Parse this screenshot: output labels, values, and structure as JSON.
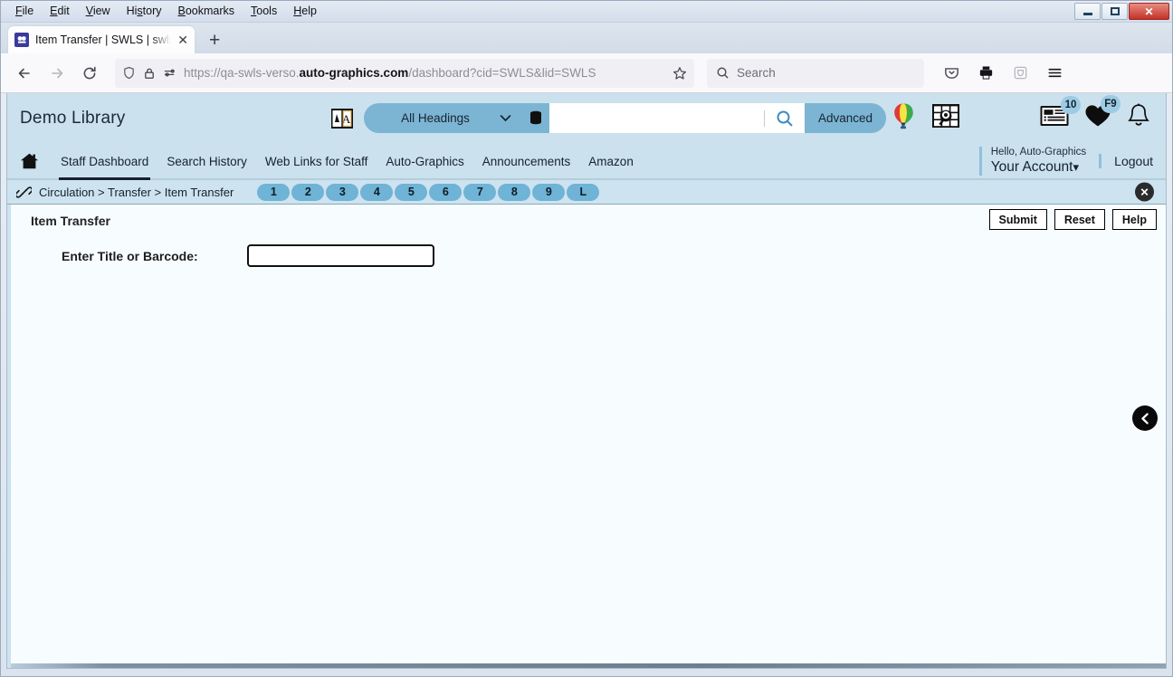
{
  "browser": {
    "menus": [
      "File",
      "Edit",
      "View",
      "History",
      "Bookmarks",
      "Tools",
      "Help"
    ],
    "window_controls": {
      "minimize": "minimize-button",
      "maximize": "maximize-button",
      "close": "✕"
    },
    "tab": {
      "title": "Item Transfer | SWLS | swls | Aut",
      "close": "✕",
      "new_tab": "+"
    },
    "url": {
      "prefix": "https://qa-swls-verso.",
      "domain": "auto-graphics.com",
      "suffix": "/dashboard?cid=SWLS&lid=SWLS"
    },
    "search": {
      "placeholder": "Search"
    }
  },
  "app": {
    "library_name": "Demo Library",
    "scope": {
      "selected": "All Headings",
      "caret": "⌄"
    },
    "search_box": {
      "value": "",
      "placeholder": ""
    },
    "advanced_label": "Advanced",
    "badges": {
      "list_count": "10",
      "favorites": "F9"
    },
    "nav": [
      {
        "label": "Staff Dashboard",
        "active": true
      },
      {
        "label": "Search History",
        "active": false
      },
      {
        "label": "Web Links for Staff",
        "active": false
      },
      {
        "label": "Auto-Graphics",
        "active": false
      },
      {
        "label": "Announcements",
        "active": false
      },
      {
        "label": "Amazon",
        "active": false
      }
    ],
    "account": {
      "greeting": "Hello, Auto-Graphics",
      "name": "Your Account",
      "caret": "⌄",
      "logout": "Logout"
    },
    "breadcrumb": {
      "path": "Circulation > Transfer > Item Transfer",
      "pills": [
        "1",
        "2",
        "3",
        "4",
        "5",
        "6",
        "7",
        "8",
        "9",
        "L"
      ],
      "close": "✕"
    },
    "content": {
      "title": "Item Transfer",
      "buttons": [
        {
          "label": "Submit",
          "name": "submit-button"
        },
        {
          "label": "Reset",
          "name": "reset-button"
        },
        {
          "label": "Help",
          "name": "help-button"
        }
      ],
      "form": {
        "field_label": "Enter Title or Barcode:",
        "field_value": "",
        "field_placeholder": ""
      },
      "side_toggle": "‹"
    }
  },
  "colors": {
    "header_bg": "#cbe1ee",
    "accent": "#7cb5d4",
    "pill": "#6fb3d6",
    "content_bg": "#f7fcfe"
  }
}
